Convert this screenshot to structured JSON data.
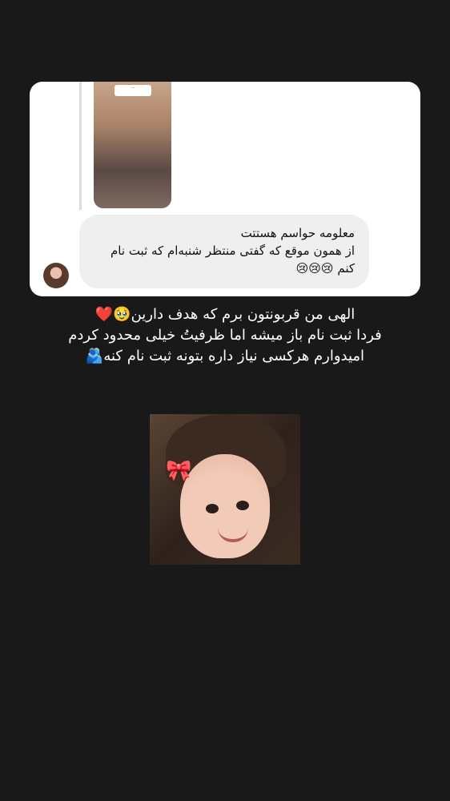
{
  "dm_reply": {
    "story_thumbnail_caption": "...",
    "message_lines": [
      "معلومه حواسم هستتت",
      "از همون موقع که گفتی منتظر شنبه‌ام که ثبت نام",
      "کنم 😢😢😢"
    ]
  },
  "story_caption": {
    "lines": [
      "الهی من قربونتون برم که هدف دارین🥹❤️",
      "فردا ثبت نام باز میشه اما ظرفیتُ خیلی محدود کردم",
      "امیدوارم هرکسی نیاز داره بتونه ثبت نام کنه🫂"
    ]
  },
  "colors": {
    "background": "#191919",
    "card": "#ffffff",
    "bubble": "#efefef",
    "caption_text": "#ffffff"
  }
}
